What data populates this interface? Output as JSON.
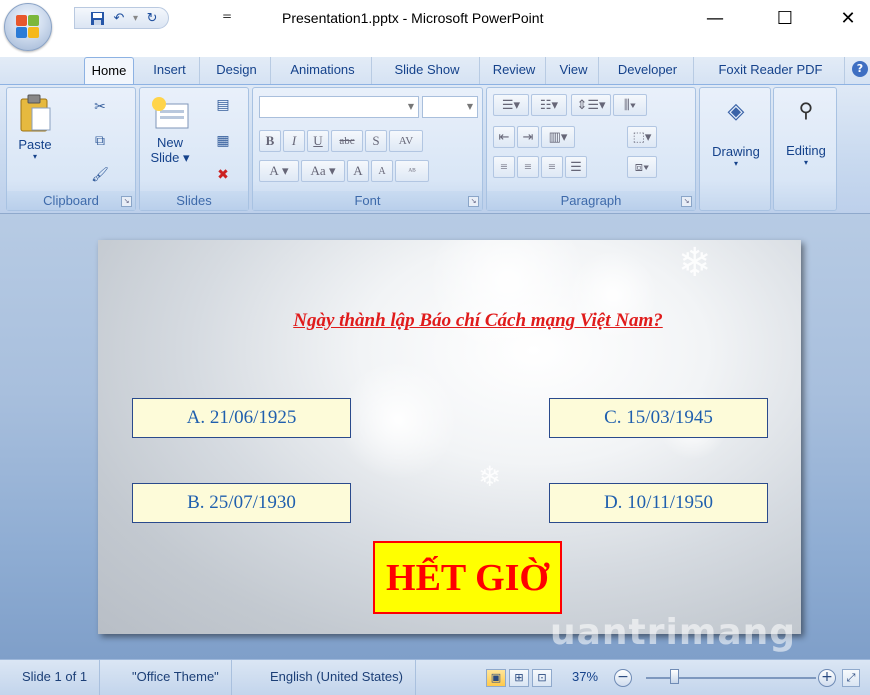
{
  "window": {
    "title": "Presentation1.pptx - Microsoft PowerPoint",
    "minimize": "—",
    "maximize": "☐",
    "close": "✕"
  },
  "quick_access": {
    "save_icon": "save-icon",
    "undo_icon": "undo-icon",
    "redo_icon": "redo-icon",
    "customize": "="
  },
  "tabs": [
    {
      "label": "Home"
    },
    {
      "label": "Insert"
    },
    {
      "label": "Design"
    },
    {
      "label": "Animations"
    },
    {
      "label": "Slide Show"
    },
    {
      "label": "Review"
    },
    {
      "label": "View"
    },
    {
      "label": "Developer"
    },
    {
      "label": "Foxit Reader PDF"
    }
  ],
  "ribbon": {
    "clipboard": {
      "label": "Clipboard",
      "paste": "Paste"
    },
    "slides": {
      "label": "Slides",
      "new_slide_1": "New",
      "new_slide_2": "Slide"
    },
    "font": {
      "label": "Font",
      "bold": "B",
      "italic": "I",
      "underline": "U",
      "strike": "abc",
      "shadow": "S",
      "spacing": "AV",
      "grow": "A",
      "shrink": "A",
      "case": "Aa"
    },
    "paragraph": {
      "label": "Paragraph"
    },
    "drawing": {
      "label": "Drawing"
    },
    "editing": {
      "label": "Editing"
    }
  },
  "slide": {
    "question": "Ngày thành lập Báo chí Cách mạng Việt Nam?",
    "answers": {
      "a": "A. 21/06/1925",
      "b": "B. 25/07/1930",
      "c": "C. 15/03/1945",
      "d": "D. 10/11/1950"
    },
    "timeout": "HẾT GIỜ"
  },
  "watermark": "uantrimang",
  "status": {
    "slide": "Slide 1 of 1",
    "theme": "\"Office Theme\"",
    "language": "English (United States)",
    "zoom": "37%"
  },
  "colors": {
    "question": "#e01b1b",
    "answer_text": "#1f5fae",
    "answer_fill": "#fdfbd9",
    "timeout_fill": "#ffff00",
    "timeout_text": "#ff0000"
  }
}
